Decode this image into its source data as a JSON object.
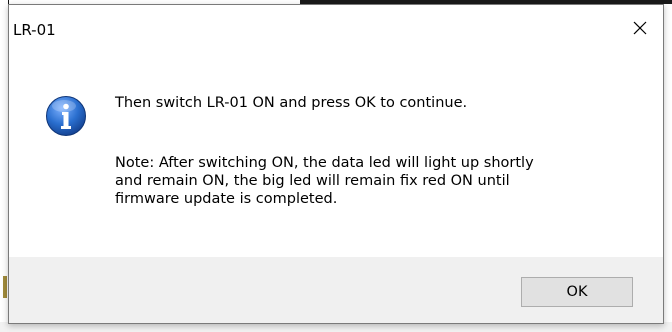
{
  "dialog": {
    "title": "LR-01",
    "close_glyph": "✕",
    "icon": "information-icon",
    "message": "Then switch LR-01 ON and press OK to continue.",
    "note_lines": [
      "Note: After switching ON, the data led will light up shortly",
      "and remain ON, the big led will remain fix red ON until",
      "firmware update is completed."
    ],
    "ok_label": "OK"
  },
  "colors": {
    "icon_blue": "#2a6fcf",
    "footer_bg": "#f0f0f0",
    "button_bg": "#e1e1e1",
    "button_border": "#adadad"
  }
}
